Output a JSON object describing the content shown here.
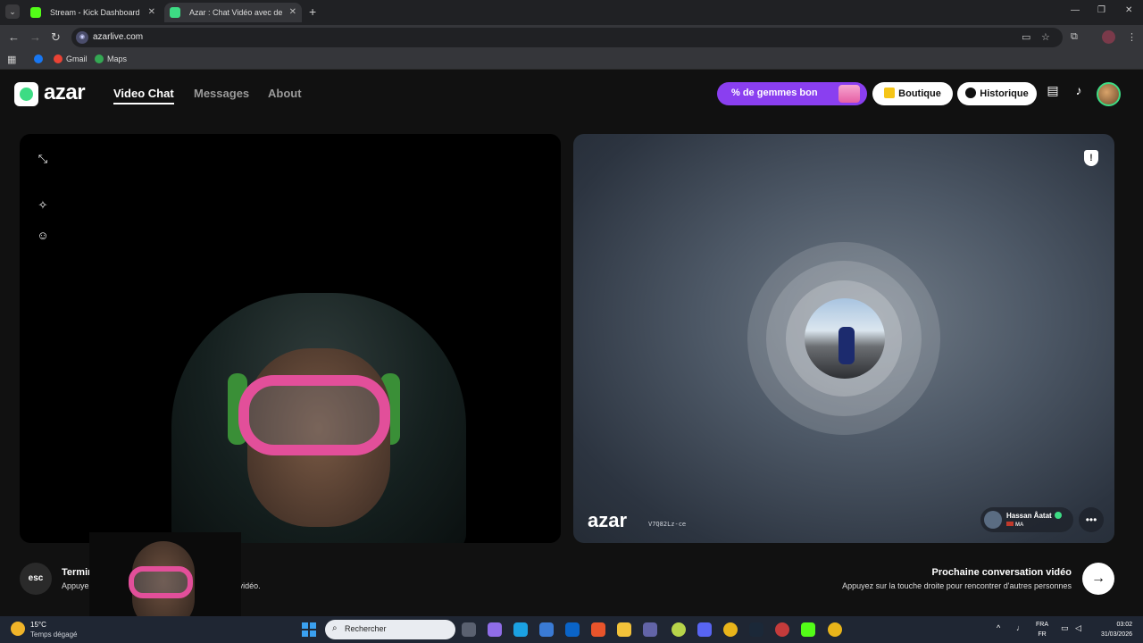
{
  "browser": {
    "tabs": [
      {
        "title": "Stream - Kick Dashboard"
      },
      {
        "title": "Azar : Chat Vidéo avec de"
      }
    ],
    "url": "azarlive.com",
    "bookmarks": [
      {
        "label": "Gmail"
      },
      {
        "label": "Maps"
      }
    ]
  },
  "site": {
    "logo": "azar",
    "nav": [
      {
        "label": "Video Chat",
        "active": true
      },
      {
        "label": "Messages",
        "active": false
      },
      {
        "label": "About",
        "active": false
      }
    ],
    "promo_label": "% de gemmes bon",
    "shop_label": "Boutique",
    "history_label": "Historique"
  },
  "remote": {
    "watermark": "azar",
    "watermark_code": "V7Q82Lz-ce",
    "user_name": "Hassan Âatat",
    "user_country": "MA"
  },
  "controls": {
    "esc_label": "esc",
    "end_title": "Terminer la",
    "end_title_tail": "o",
    "end_subtitle": "Appuyez sur",
    "end_subtitle_tail": "e fin au chat vidéo.",
    "next_title": "Prochaine conversation vidéo",
    "next_subtitle": "Appuyez sur la touche droite pour rencontrer d'autres personnes"
  },
  "taskbar": {
    "temperature": "15°C",
    "weather": "Temps dégagé",
    "search_placeholder": "Rechercher",
    "lang_top": "FRA",
    "lang_bottom": "FR",
    "time": "03:02",
    "date": "31/03/2026"
  },
  "colors": {
    "accent_green": "#3ddc84",
    "promo_purple": "#8a3ff0",
    "mask_pink": "#e24f9a"
  }
}
